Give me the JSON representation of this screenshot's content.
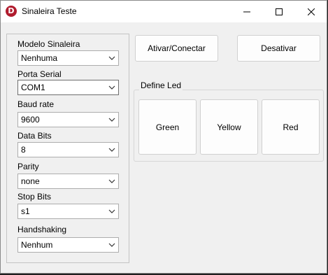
{
  "window": {
    "title": "Sinaleira Teste",
    "icon_letter": "D",
    "controls": [
      "minimize-icon",
      "maximize-icon",
      "close-icon"
    ]
  },
  "fields": [
    {
      "label": "Modelo Sinaleira",
      "value": "Nenhuma"
    },
    {
      "label": "Porta Serial",
      "value": "COM1"
    },
    {
      "label": "Baud rate",
      "value": "9600"
    },
    {
      "label": "Data Bits",
      "value": "8"
    },
    {
      "label": "Parity",
      "value": "none"
    },
    {
      "label": "Stop Bits",
      "value": "s1"
    },
    {
      "label": "Handshaking",
      "value": "Nenhum"
    }
  ],
  "buttons": {
    "connect": "Ativar/Conectar",
    "disconnect": "Desativar"
  },
  "led_group": {
    "title": "Define Led",
    "green": "Green",
    "yellow": "Yellow",
    "red": "Red"
  },
  "colors": {
    "icon_bg": "#b01c2e",
    "window_bg": "#f0f0f0"
  }
}
